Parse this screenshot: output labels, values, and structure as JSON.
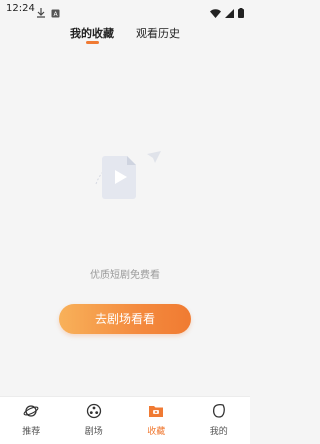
{
  "status_bar": {
    "time": "12:24"
  },
  "tabs": [
    {
      "label": "我的收藏",
      "active": true
    },
    {
      "label": "观看历史",
      "active": false
    }
  ],
  "empty_state": {
    "message": "优质短剧免费看"
  },
  "cta": {
    "label": "去剧场看看"
  },
  "bottom_nav": {
    "items": [
      {
        "label": "推荐",
        "icon": "planet-icon"
      },
      {
        "label": "剧场",
        "icon": "film-reel-icon"
      },
      {
        "label": "收藏",
        "icon": "bookmark-folder-icon",
        "active": true
      },
      {
        "label": "我的",
        "icon": "leaf-icon"
      }
    ]
  },
  "colors": {
    "accent": "#f07a33",
    "background": "#f5f5f5"
  }
}
